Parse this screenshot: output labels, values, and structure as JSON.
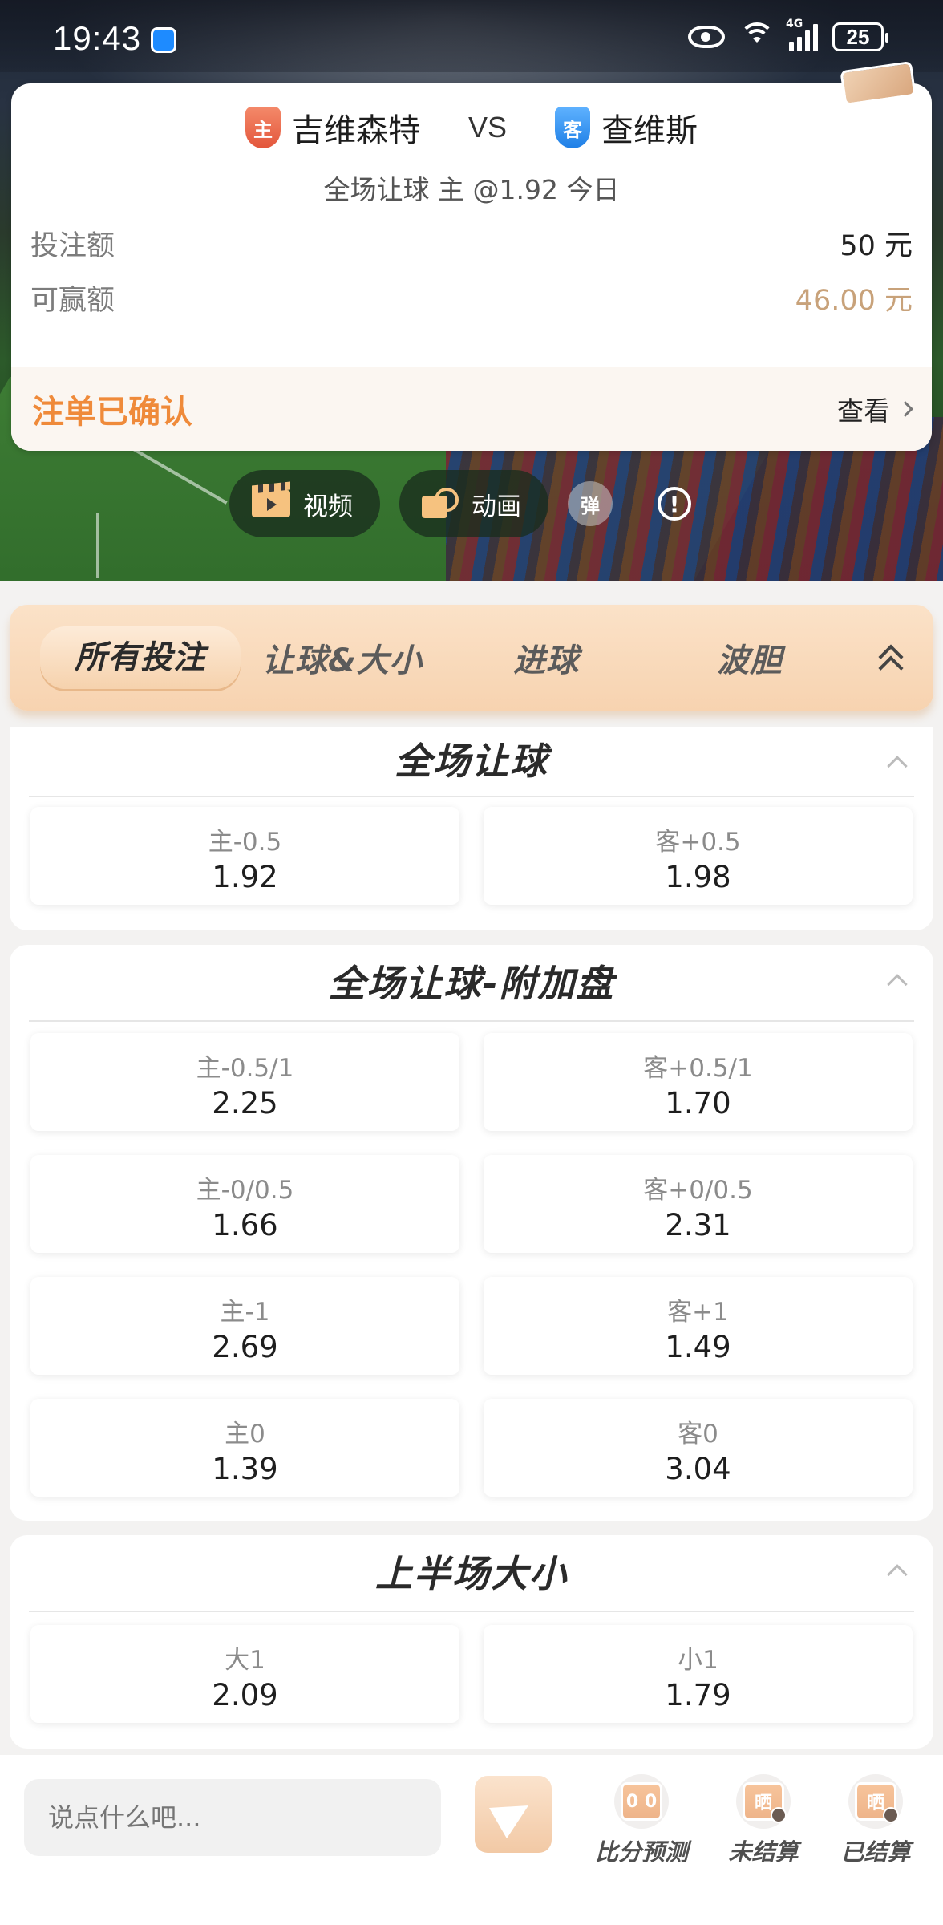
{
  "status_bar": {
    "time": "19:43",
    "network": "4G",
    "battery": "25"
  },
  "bet_card": {
    "home_team": "吉维森特",
    "home_badge": "主",
    "away_team": "查维斯",
    "away_badge": "客",
    "vs": "VS",
    "bet_desc": "全场让球 主 @1.92 今日",
    "stake_label": "投注额",
    "stake_value": "50 元",
    "win_label": "可赢额",
    "win_value": "46.00 元",
    "status": "注单已确认",
    "view_link": "查看"
  },
  "media": {
    "video_label": "视频",
    "animation_label": "动画",
    "danmu_label": "弹",
    "info_label": "!"
  },
  "tabs": [
    {
      "label": "所有投注",
      "active": true
    },
    {
      "label": "让球&大小",
      "active": false
    },
    {
      "label": "进球",
      "active": false
    },
    {
      "label": "波胆",
      "active": false
    }
  ],
  "sections": [
    {
      "title": "全场让球",
      "odds": [
        {
          "label": "主-0.5",
          "value": "1.92"
        },
        {
          "label": "客+0.5",
          "value": "1.98"
        }
      ]
    },
    {
      "title": "全场让球-附加盘",
      "odds": [
        {
          "label": "主-0.5/1",
          "value": "2.25"
        },
        {
          "label": "客+0.5/1",
          "value": "1.70"
        },
        {
          "label": "主-0/0.5",
          "value": "1.66"
        },
        {
          "label": "客+0/0.5",
          "value": "2.31"
        },
        {
          "label": "主-1",
          "value": "2.69"
        },
        {
          "label": "客+1",
          "value": "1.49"
        },
        {
          "label": "主0",
          "value": "1.39"
        },
        {
          "label": "客0",
          "value": "3.04"
        }
      ]
    },
    {
      "title": "上半场大小",
      "odds": [
        {
          "label": "大1",
          "value": "2.09"
        },
        {
          "label": "小1",
          "value": "1.79"
        }
      ]
    }
  ],
  "bottom_bar": {
    "input_placeholder": "说点什么吧...",
    "tools": [
      {
        "label": "比分预测",
        "icon_text": "0 0"
      },
      {
        "label": "未结算",
        "icon_text": "晒"
      },
      {
        "label": "已结算",
        "icon_text": "晒"
      }
    ]
  },
  "colors": {
    "accent_orange": "#ef8a3a",
    "gold_text": "#c8a27a",
    "tab_bg": "#f7d3b0"
  }
}
